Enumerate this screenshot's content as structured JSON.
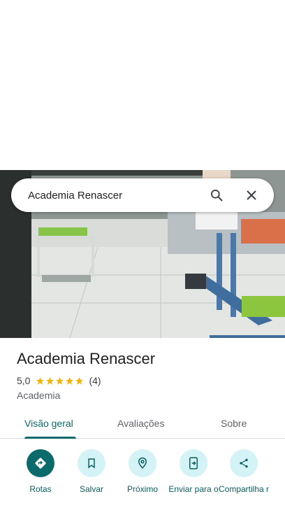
{
  "search": {
    "query": "Academia Renascer"
  },
  "place": {
    "name": "Academia Renascer",
    "rating": "5,0",
    "stars": 5,
    "review_count": "(4)",
    "category": "Academia"
  },
  "tabs": [
    {
      "label": "Visão geral",
      "active": true
    },
    {
      "label": "Avaliações",
      "active": false
    },
    {
      "label": "Sobre",
      "active": false
    }
  ],
  "actions": [
    {
      "label": "Rotas",
      "icon": "directions-icon"
    },
    {
      "label": "Salvar",
      "icon": "bookmark-icon"
    },
    {
      "label": "Próximo",
      "icon": "nearby-icon"
    },
    {
      "label": "Enviar para o",
      "icon": "send-to-phone-icon"
    },
    {
      "label": "Compartilha r",
      "icon": "share-icon"
    }
  ],
  "colors": {
    "accent": "#0b6b6b",
    "action_bg": "#d4f3f6",
    "star": "#f4b400"
  }
}
